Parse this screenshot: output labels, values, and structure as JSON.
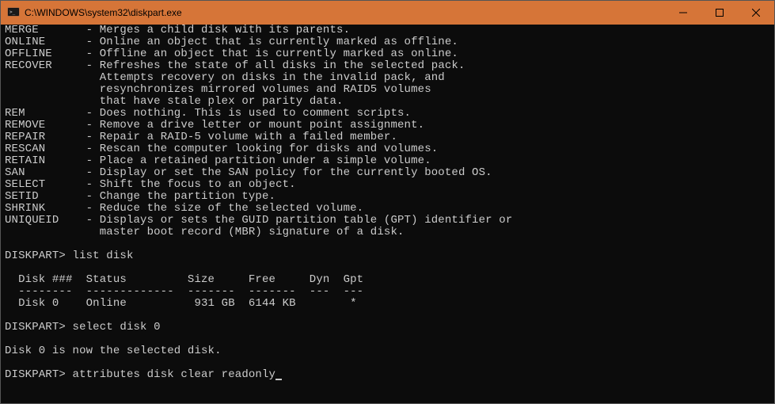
{
  "titlebar": {
    "title": "C:\\WINDOWS\\system32\\diskpart.exe"
  },
  "help": {
    "merge_cmd": "MERGE",
    "merge_desc": "Merges a child disk with its parents.",
    "online_cmd": "ONLINE",
    "online_desc": "Online an object that is currently marked as offline.",
    "offline_cmd": "OFFLINE",
    "offline_desc": "Offline an object that is currently marked as online.",
    "recover_cmd": "RECOVER",
    "recover_desc1": "Refreshes the state of all disks in the selected pack.",
    "recover_desc2": "Attempts recovery on disks in the invalid pack, and",
    "recover_desc3": "resynchronizes mirrored volumes and RAID5 volumes",
    "recover_desc4": "that have stale plex or parity data.",
    "rem_cmd": "REM",
    "rem_desc": "Does nothing. This is used to comment scripts.",
    "remove_cmd": "REMOVE",
    "remove_desc": "Remove a drive letter or mount point assignment.",
    "repair_cmd": "REPAIR",
    "repair_desc": "Repair a RAID-5 volume with a failed member.",
    "rescan_cmd": "RESCAN",
    "rescan_desc": "Rescan the computer looking for disks and volumes.",
    "retain_cmd": "RETAIN",
    "retain_desc": "Place a retained partition under a simple volume.",
    "san_cmd": "SAN",
    "san_desc": "Display or set the SAN policy for the currently booted OS.",
    "select_cmd": "SELECT",
    "select_desc": "Shift the focus to an object.",
    "setid_cmd": "SETID",
    "setid_desc": "Change the partition type.",
    "shrink_cmd": "SHRINK",
    "shrink_desc": "Reduce the size of the selected volume.",
    "uniqueid_cmd": "UNIQUEID",
    "uniqueid_desc1": "Displays or sets the GUID partition table (GPT) identifier or",
    "uniqueid_desc2": "master boot record (MBR) signature of a disk."
  },
  "session": {
    "prompt1": "DISKPART>",
    "cmd1": "list disk",
    "table_header": "  Disk ###  Status         Size     Free     Dyn  Gpt",
    "table_divider": "  --------  -------------  -------  -------  ---  ---",
    "table_row": "  Disk 0    Online          931 GB  6144 KB        *",
    "prompt2": "DISKPART>",
    "cmd2": "select disk 0",
    "response2": "Disk 0 is now the selected disk.",
    "prompt3": "DISKPART>",
    "cmd3": "attributes disk clear readonly"
  }
}
